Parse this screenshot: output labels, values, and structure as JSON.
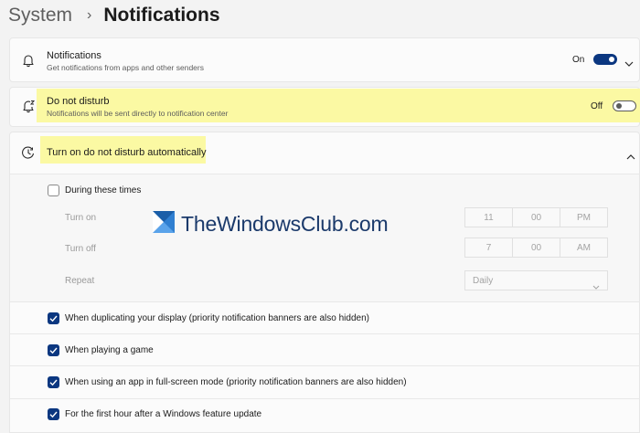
{
  "breadcrumb": {
    "parent": "System",
    "separator": "›",
    "current": "Notifications"
  },
  "notifications": {
    "icon": "bell-icon",
    "title": "Notifications",
    "subtitle": "Get notifications from apps and other senders",
    "state": "On",
    "toggle_on": true
  },
  "dnd": {
    "icon": "bell-snooze-icon",
    "title": "Do not disturb",
    "subtitle": "Notifications will be sent directly to notification center",
    "state": "Off",
    "toggle_on": false,
    "highlight_color": "#fbf9a3"
  },
  "auto_dnd": {
    "icon": "clock-icon",
    "title": "Turn on do not disturb automatically",
    "expanded": true,
    "during_times": {
      "label": "During these times",
      "checked": false,
      "turn_on": {
        "label": "Turn on",
        "hour": "11",
        "minute": "00",
        "period": "PM"
      },
      "turn_off": {
        "label": "Turn off",
        "hour": "7",
        "minute": "00",
        "period": "AM"
      },
      "repeat": {
        "label": "Repeat",
        "value": "Daily"
      }
    },
    "conditions": [
      {
        "label": "When duplicating your display (priority notification banners are also hidden)",
        "checked": true
      },
      {
        "label": "When playing a game",
        "checked": true
      },
      {
        "label": "When using an app in full-screen mode (priority notification banners are also hidden)",
        "checked": true
      },
      {
        "label": "For the first hour after a Windows feature update",
        "checked": true
      }
    ]
  },
  "watermark": {
    "text": "TheWindowsClub.com"
  },
  "colors": {
    "accent": "#0b3780",
    "highlight": "#fbf9a3",
    "background": "#f3f3f3"
  }
}
